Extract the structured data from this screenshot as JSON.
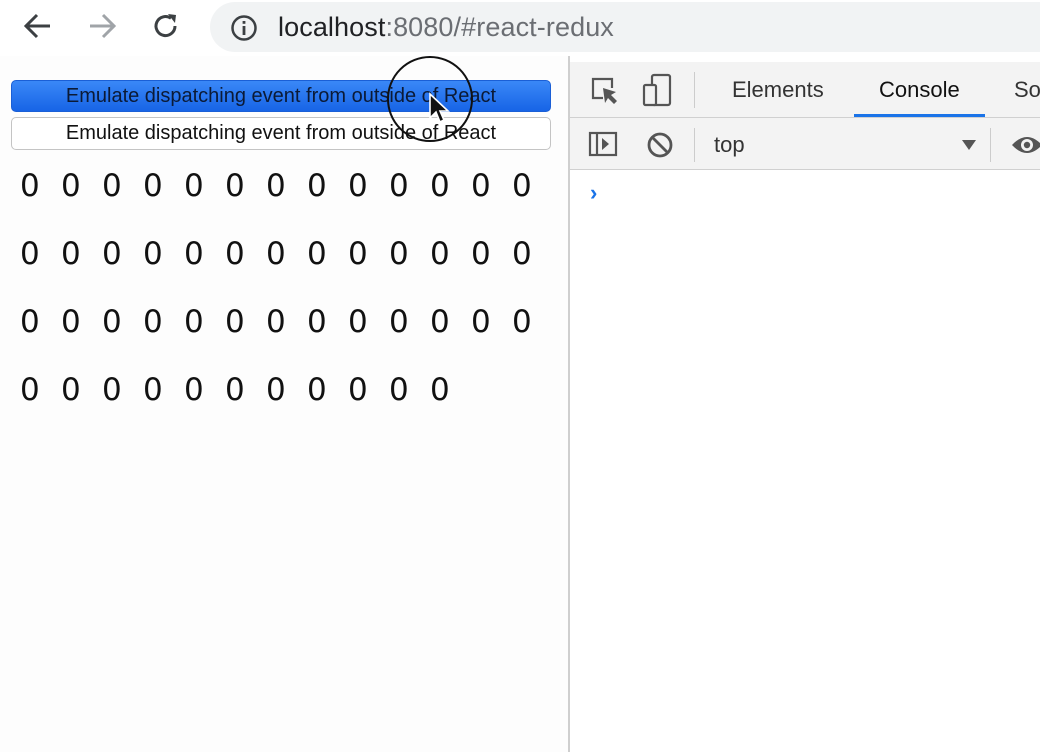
{
  "browser": {
    "url_host": "localhost",
    "url_rest": ":8080/#react-redux",
    "back_icon": "arrow-left-icon",
    "forward_icon": "arrow-right-icon",
    "reload_icon": "reload-icon",
    "info_icon": "info-icon"
  },
  "page": {
    "buttons": [
      {
        "label": "Emulate dispatching event from outside of React",
        "style": "pressed",
        "color": "#1764e6"
      },
      {
        "label": "Emulate dispatching event from outside of React",
        "style": "default"
      }
    ],
    "counter_rows": [
      [
        "0",
        "0",
        "0",
        "0",
        "0",
        "0",
        "0",
        "0",
        "0",
        "0",
        "0",
        "0",
        "0"
      ],
      [
        "0",
        "0",
        "0",
        "0",
        "0",
        "0",
        "0",
        "0",
        "0",
        "0",
        "0",
        "0",
        "0"
      ],
      [
        "0",
        "0",
        "0",
        "0",
        "0",
        "0",
        "0",
        "0",
        "0",
        "0",
        "0",
        "0",
        "0"
      ],
      [
        "0",
        "0",
        "0",
        "0",
        "0",
        "0",
        "0",
        "0",
        "0",
        "0",
        "0"
      ]
    ]
  },
  "devtools": {
    "tabs": [
      {
        "label": "Elements",
        "active": false
      },
      {
        "label": "Console",
        "active": true
      },
      {
        "label": "So",
        "active": false
      }
    ],
    "context": "top",
    "prompt": "›",
    "accent": "#1a73e8"
  }
}
